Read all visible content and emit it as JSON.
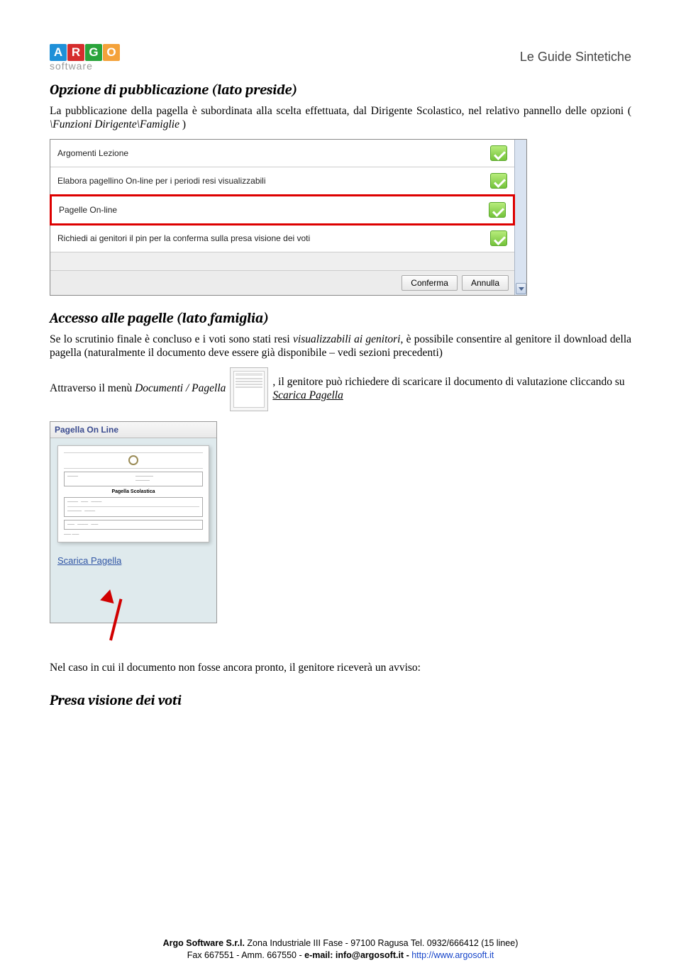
{
  "logo": {
    "c1": "A",
    "c2": "R",
    "c3": "G",
    "c4": "O",
    "label": "software"
  },
  "header": {
    "guide_title": "Le Guide Sintetiche"
  },
  "section1": {
    "title": "Opzione di pubblicazione (lato preside)",
    "para": "La pubblicazione della pagella è subordinata alla scelta effettuata, dal Dirigente Scolastico, nel relativo pannello delle opzioni ( ",
    "para_ital": "\\Funzioni Dirigente\\Famiglie",
    "para_end": " )"
  },
  "shot1": {
    "rows": [
      {
        "label": "Argomenti Lezione",
        "highlight": false
      },
      {
        "label": "Elabora pagellino On-line per i periodi resi visualizzabili",
        "highlight": false
      },
      {
        "label": "Pagelle On-line",
        "highlight": true
      },
      {
        "label": "Richiedi ai genitori il pin per la conferma sulla presa visione dei voti",
        "highlight": false
      }
    ],
    "confirm": "Conferma",
    "cancel": "Annulla"
  },
  "section2": {
    "title": "Accesso alle pagelle (lato famiglia)",
    "para_a": "Se lo scrutinio finale è concluso e i voti sono stati resi ",
    "para_b": "visualizzabili ai genitori",
    "para_c": ", è possibile consentire al genitore il download della pagella (naturalmente il documento deve essere già disponibile – vedi sezioni precedenti)"
  },
  "inline": {
    "text_a": "Attraverso il menù ",
    "text_b": "Documenti / Pagella",
    "text_c": ", il genitore può richiedere di scaricare il documento di valutazione cliccando su ",
    "text_d": "Scarica Pagella"
  },
  "shot2": {
    "titlebar": "Pagella On Line",
    "sheet_title": "Pagella Scolastica",
    "link": "Scarica Pagella"
  },
  "closing": {
    "text": "Nel caso in cui il documento non fosse ancora pronto, il genitore riceverà un avviso:"
  },
  "section3": {
    "title": "Presa visione dei voti"
  },
  "footer": {
    "l1a": "Argo Software S.r.l.",
    "l1b": " Zona Industriale III Fase - 97100 Ragusa Tel. 0932/666412 (15 linee)",
    "l2a": "Fax 667551 - Amm. 667550 - ",
    "l2b": "e-mail: info@argosoft.it - ",
    "l2c": "http://www.argosoft.it"
  }
}
